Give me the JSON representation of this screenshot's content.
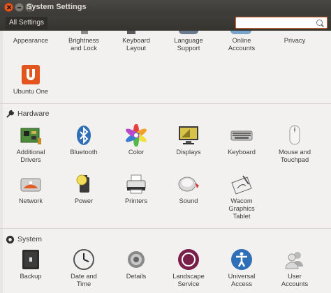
{
  "window": {
    "title": "System Settings"
  },
  "toolbar": {
    "all_settings_label": "All Settings",
    "search_value": "",
    "search_placeholder": ""
  },
  "personal_top_row": [
    {
      "label": "Appearance"
    },
    {
      "label": "Brightness\nand Lock"
    },
    {
      "label": "Keyboard\nLayout"
    },
    {
      "label": "Language\nSupport"
    },
    {
      "label": "Online\nAccounts"
    },
    {
      "label": "Privacy"
    }
  ],
  "personal_extra": [
    {
      "label": "Ubuntu One"
    }
  ],
  "hardware": {
    "title": "Hardware",
    "items": [
      {
        "label": "Additional\nDrivers"
      },
      {
        "label": "Bluetooth"
      },
      {
        "label": "Color"
      },
      {
        "label": "Displays"
      },
      {
        "label": "Keyboard"
      },
      {
        "label": "Mouse and\nTouchpad"
      },
      {
        "label": "Network"
      },
      {
        "label": "Power"
      },
      {
        "label": "Printers"
      },
      {
        "label": "Sound"
      },
      {
        "label": "Wacom\nGraphics\nTablet"
      }
    ]
  },
  "system": {
    "title": "System",
    "items": [
      {
        "label": "Backup"
      },
      {
        "label": "Date and\nTime"
      },
      {
        "label": "Details"
      },
      {
        "label": "Landscape\nService"
      },
      {
        "label": "Universal\nAccess"
      },
      {
        "label": "User\nAccounts"
      }
    ]
  },
  "colors": {
    "accent": "#e65a27",
    "titlebar": "#3c3b37",
    "background": "#f2f1f0"
  }
}
